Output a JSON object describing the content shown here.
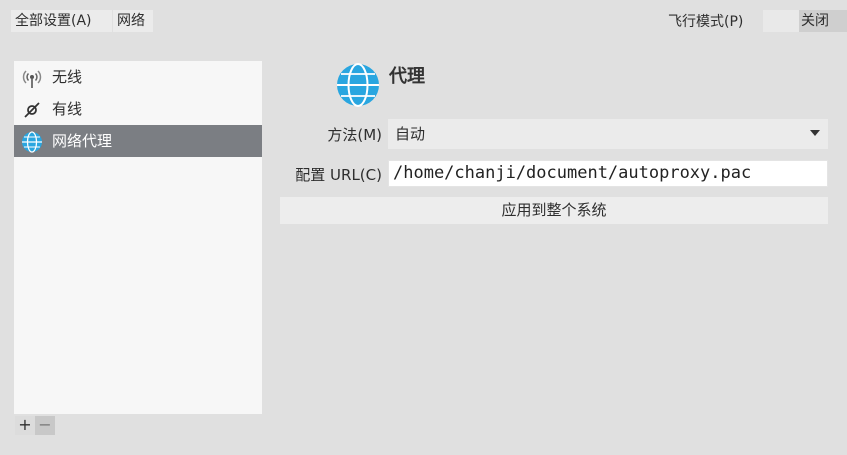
{
  "header": {
    "all_settings_label": "全部设置(A)",
    "breadcrumb": "网络",
    "airplane_mode_label": "飞行模式(P)",
    "airplane_mode_state": "关闭"
  },
  "sidebar": {
    "items": [
      {
        "label": "无线",
        "icon": "wireless-icon",
        "selected": false
      },
      {
        "label": "有线",
        "icon": "wired-icon",
        "selected": false
      },
      {
        "label": "网络代理",
        "icon": "globe-icon",
        "selected": true
      }
    ],
    "add_label": "+",
    "remove_label": "−"
  },
  "main": {
    "title": "代理",
    "icon": "globe-icon",
    "method_label": "方法(M)",
    "method_value": "自动",
    "url_label": "配置 URL(C)",
    "url_value": "/home/chanji/document/autoproxy.pac",
    "apply_label": "应用到整个系统"
  },
  "colors": {
    "window_bg": "#e0e0e0",
    "sidebar_bg": "#f7f7f7",
    "selected_bg": "#7b7e83",
    "globe_blue": "#29a6e0"
  }
}
